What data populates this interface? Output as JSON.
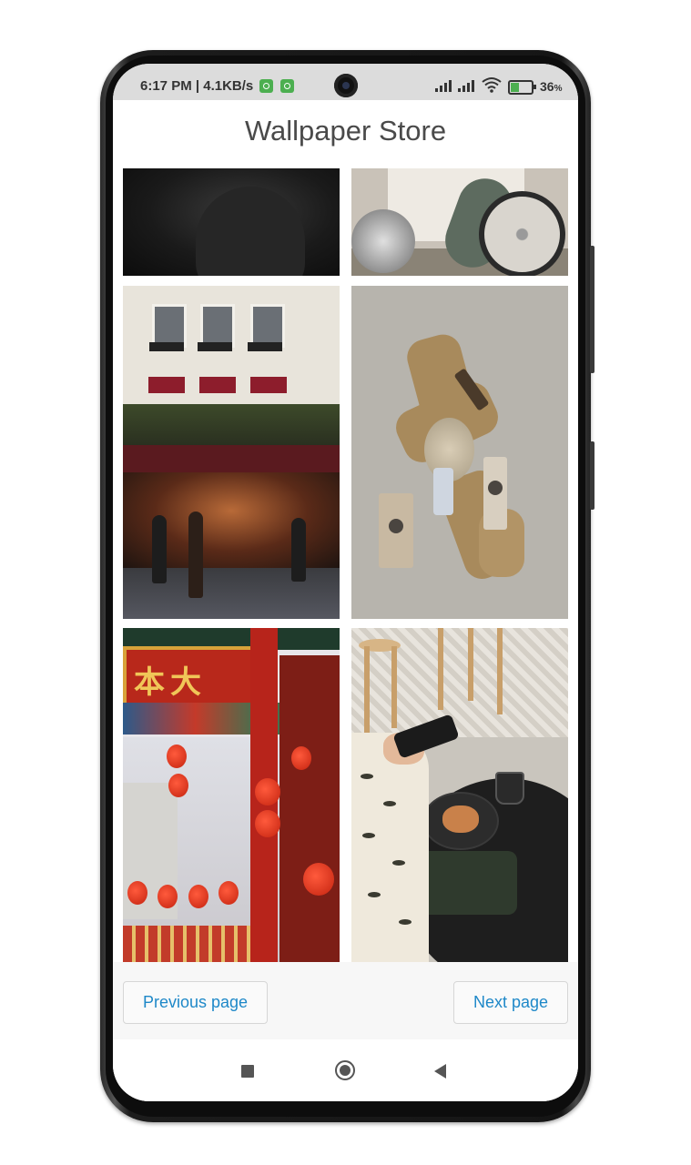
{
  "status_bar": {
    "time": "6:17 PM | 4.1KB/s",
    "battery_percent": "36",
    "battery_suffix": "%",
    "icons": [
      "notification-badge-icon",
      "notification-badge-icon",
      "signal-icon",
      "signal-icon",
      "wifi-icon",
      "battery-charging-icon"
    ]
  },
  "app": {
    "title": "Wallpaper Store"
  },
  "gallery": {
    "tiles": [
      {
        "subject": "dark portrait"
      },
      {
        "subject": "vintage motorcycle"
      },
      {
        "subject": "paris cafe facade"
      },
      {
        "subject": "ribbon gift flatlay"
      },
      {
        "subject": "chinatown lanterns gate"
      },
      {
        "subject": "cafe table with phone and bag"
      }
    ]
  },
  "pagination": {
    "previous_label": "Previous page",
    "next_label": "Next page"
  },
  "colors": {
    "accent": "#1e88c8",
    "title": "#4a4a4a",
    "status_bar_bg": "#dcdcdc"
  }
}
